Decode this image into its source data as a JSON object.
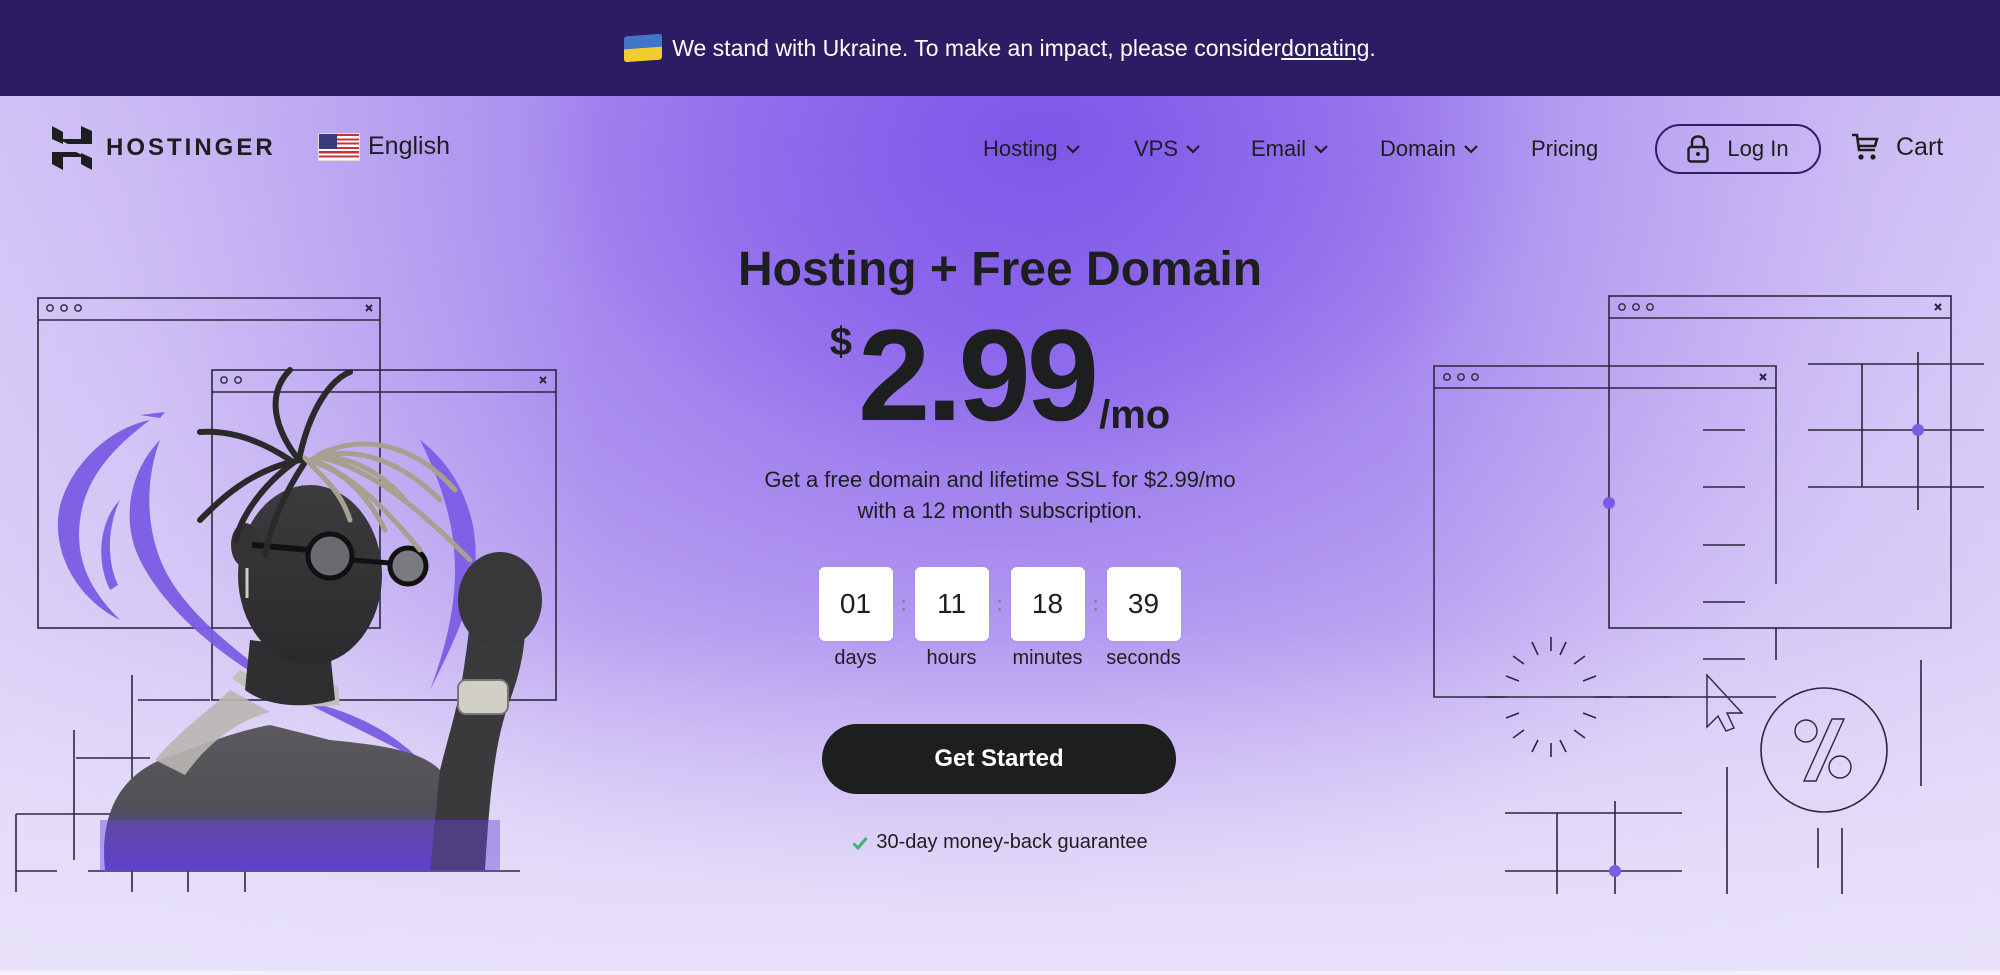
{
  "announcement": {
    "flag_icon": "ukraine-flag-icon",
    "text": "We stand with Ukraine. To make an impact, please consider ",
    "link_label": "donating",
    "trailing": "."
  },
  "nav": {
    "brand": "HOSTINGER",
    "language": {
      "flag_icon": "us-flag-icon",
      "label": "English"
    },
    "menu": [
      {
        "label": "Hosting",
        "has_dropdown": true
      },
      {
        "label": "VPS",
        "has_dropdown": true
      },
      {
        "label": "Email",
        "has_dropdown": true
      },
      {
        "label": "Domain",
        "has_dropdown": true
      },
      {
        "label": "Pricing",
        "has_dropdown": false
      }
    ],
    "login_label": "Log In",
    "cart_label": "Cart"
  },
  "hero": {
    "headline": "Hosting + Free Domain",
    "price": {
      "currency": "$",
      "amount": "2.99",
      "period": "/mo"
    },
    "subtitle_line1": "Get a free domain and lifetime SSL for $2.99/mo",
    "subtitle_line2": "with a 12 month subscription.",
    "countdown": [
      {
        "value": "01",
        "label": "days"
      },
      {
        "value": "11",
        "label": "hours"
      },
      {
        "value": "18",
        "label": "minutes"
      },
      {
        "value": "39",
        "label": "seconds"
      }
    ],
    "countdown_separator": ":",
    "cta_label": "Get Started",
    "guarantee": "30-day money-back guarantee"
  },
  "colors": {
    "announcement_bg": "#2b1c64",
    "accent_purple": "#7b5ce5",
    "dark": "#1d1e20",
    "check_green": "#3fb37a"
  }
}
